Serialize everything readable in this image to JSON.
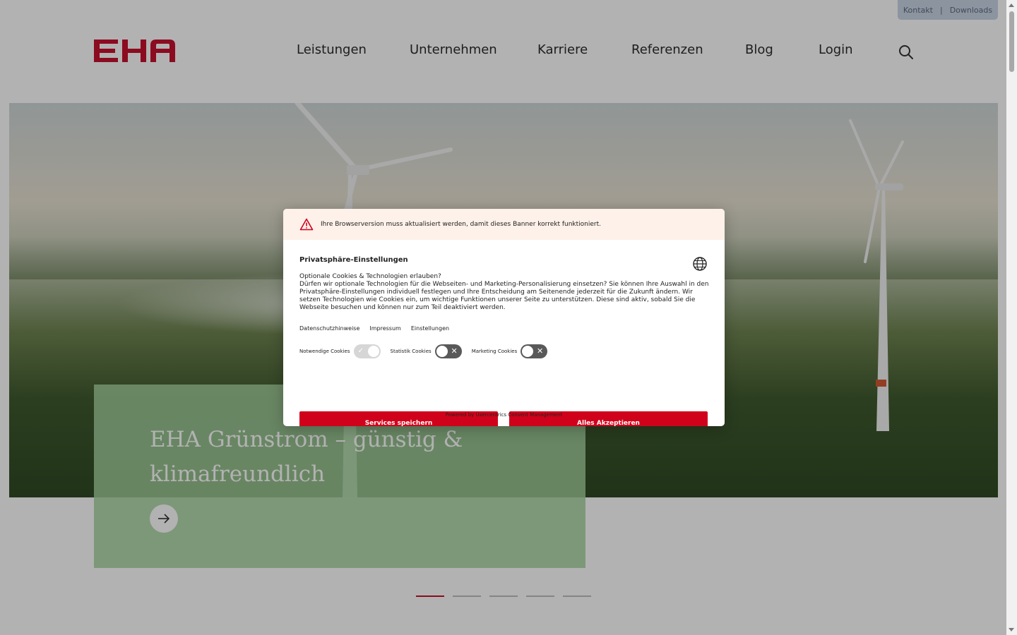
{
  "topbar": {
    "kontakt": "Kontakt",
    "separator": "|",
    "downloads": "Downloads"
  },
  "header": {
    "logo_text": "EHA",
    "nav": [
      "Leistungen",
      "Unternehmen",
      "Karriere",
      "Referenzen",
      "Blog",
      "Login"
    ],
    "search_icon": "search-icon"
  },
  "hero": {
    "card_title": "EHA Grünstrom – günstig & klimafreundlich",
    "arrow_icon": "arrow-right-icon"
  },
  "slider": {
    "active_index": 0,
    "count": 5
  },
  "consent": {
    "warning": "Ihre Browserversion muss aktualisiert werden, damit dieses Banner korrekt funktioniert.",
    "title": "Privatsphäre-Einstellungen",
    "question": "Optionale Cookies & Technologien erlauben?",
    "description": "Dürfen wir optionale Technologien für die Webseiten- und Marketing-Personalisierung einsetzen? Sie können Ihre Auswahl in den Privatsphäre-Einstellungen individuell festlegen und Ihre Entscheidung am Seitenende jederzeit für die Zukunft ändern. Wir setzen Technologien wie Cookies ein, um wichtige Funktionen unserer Seite zu unterstützen. Diese sind aktiv, sobald Sie die Webseite besuchen und können nur zum Teil deaktiviert werden.",
    "links": [
      "Datenschutzhinweise",
      "Impressum",
      "Einstellungen"
    ],
    "toggles": [
      {
        "label": "Notwendige Cookies",
        "state": "on-disabled"
      },
      {
        "label": "Statistik Cookies",
        "state": "off"
      },
      {
        "label": "Marketing Cookies",
        "state": "off"
      }
    ],
    "save_button": "Services speichern",
    "accept_button": "Alles Akzeptieren",
    "powered_by": "Powered by Usercentrics Consent Management"
  },
  "colors": {
    "brand_red": "#c8102e",
    "button_red": "#d0021b",
    "card_green": "#a7d4a0"
  }
}
